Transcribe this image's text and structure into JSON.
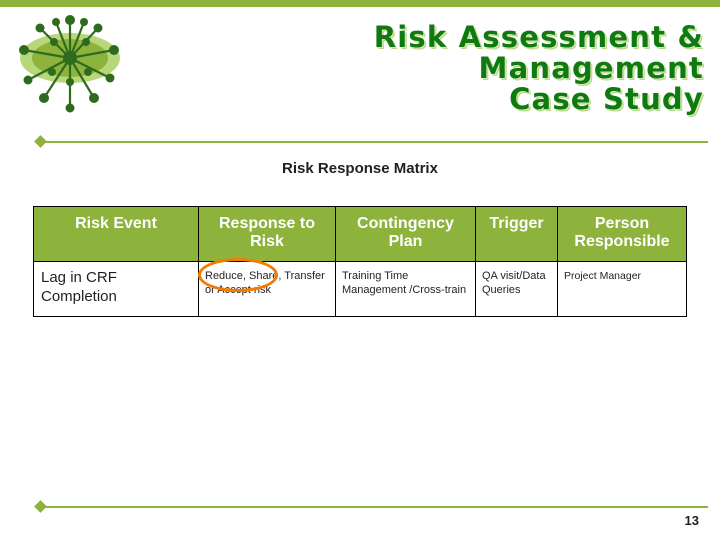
{
  "slide": {
    "title_lines": [
      "Risk Assessment &",
      "Management",
      "Case Study"
    ],
    "section_heading": "Risk Response Matrix",
    "page_number": "13",
    "accent_color": "#8db33c",
    "title_color": "#0f7a0f",
    "annotation_color": "#f07d00",
    "logo_name": "green-burst-logo"
  },
  "table": {
    "headers": [
      "Risk Event",
      "Response to Risk",
      "Contingency Plan",
      "Trigger",
      "Person Responsible"
    ],
    "rows": [
      {
        "risk_event": "Lag in CRF Completion",
        "response": "Reduce, Share, Transfer or Accept risk",
        "contingency": "Training Time Management /Cross-train",
        "trigger": "QA visit/Data Queries",
        "person": "Project Manager"
      }
    ]
  }
}
